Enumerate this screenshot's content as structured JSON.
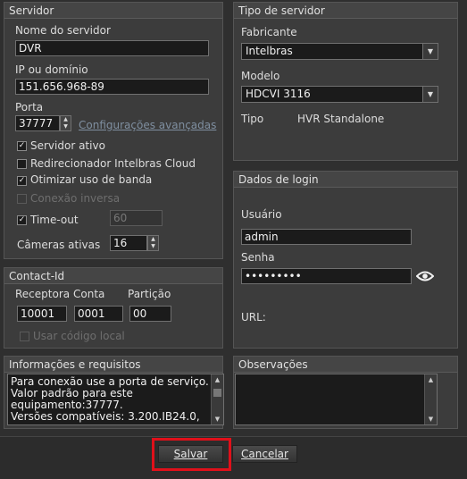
{
  "servidor": {
    "title": "Servidor",
    "nome_label": "Nome do servidor",
    "nome_value": "DVR",
    "ip_label": "IP ou domínio",
    "ip_value": "151.656.968-89",
    "porta_label": "Porta",
    "porta_value": "37777",
    "config_avancadas": "Configurações avançadas",
    "servidor_ativo": "Servidor ativo",
    "redirecionador": "Redirecionador Intelbras Cloud",
    "otimizar": "Otimizar uso de banda",
    "conexao_inversa": "Conexão inversa",
    "timeout_label": "Time-out",
    "timeout_value": "60",
    "cameras_label": "Câmeras ativas",
    "cameras_value": "16"
  },
  "tipo_servidor": {
    "title": "Tipo de servidor",
    "fabricante_label": "Fabricante",
    "fabricante_value": "Intelbras",
    "modelo_label": "Modelo",
    "modelo_value": "HDCVI 3116",
    "tipo_label": "Tipo",
    "tipo_value": "HVR Standalone"
  },
  "login": {
    "title": "Dados de login",
    "usuario_label": "Usuário",
    "usuario_value": "admin",
    "senha_label": "Senha",
    "senha_value": "•••••••••",
    "url_label": "URL:"
  },
  "contact_id": {
    "title": "Contact-Id",
    "receptora_label": "Receptora",
    "receptora_value": "10001",
    "conta_label": "Conta",
    "conta_value": "0001",
    "particao_label": "Partição",
    "particao_value": "00",
    "usar_codigo": "Usar código local"
  },
  "info": {
    "title": "Informações e requisitos",
    "lines": [
      "Para conexão use a porta de serviço.",
      "Valor padrão para este",
      "equipamento:37777.",
      "Versões compatíveis: 3.200.IB24.0,"
    ]
  },
  "observacoes": {
    "title": "Observações"
  },
  "footer": {
    "salvar": "Salvar",
    "cancelar": "Cancelar"
  },
  "accent": {
    "highlight_border": "#e0101a"
  }
}
